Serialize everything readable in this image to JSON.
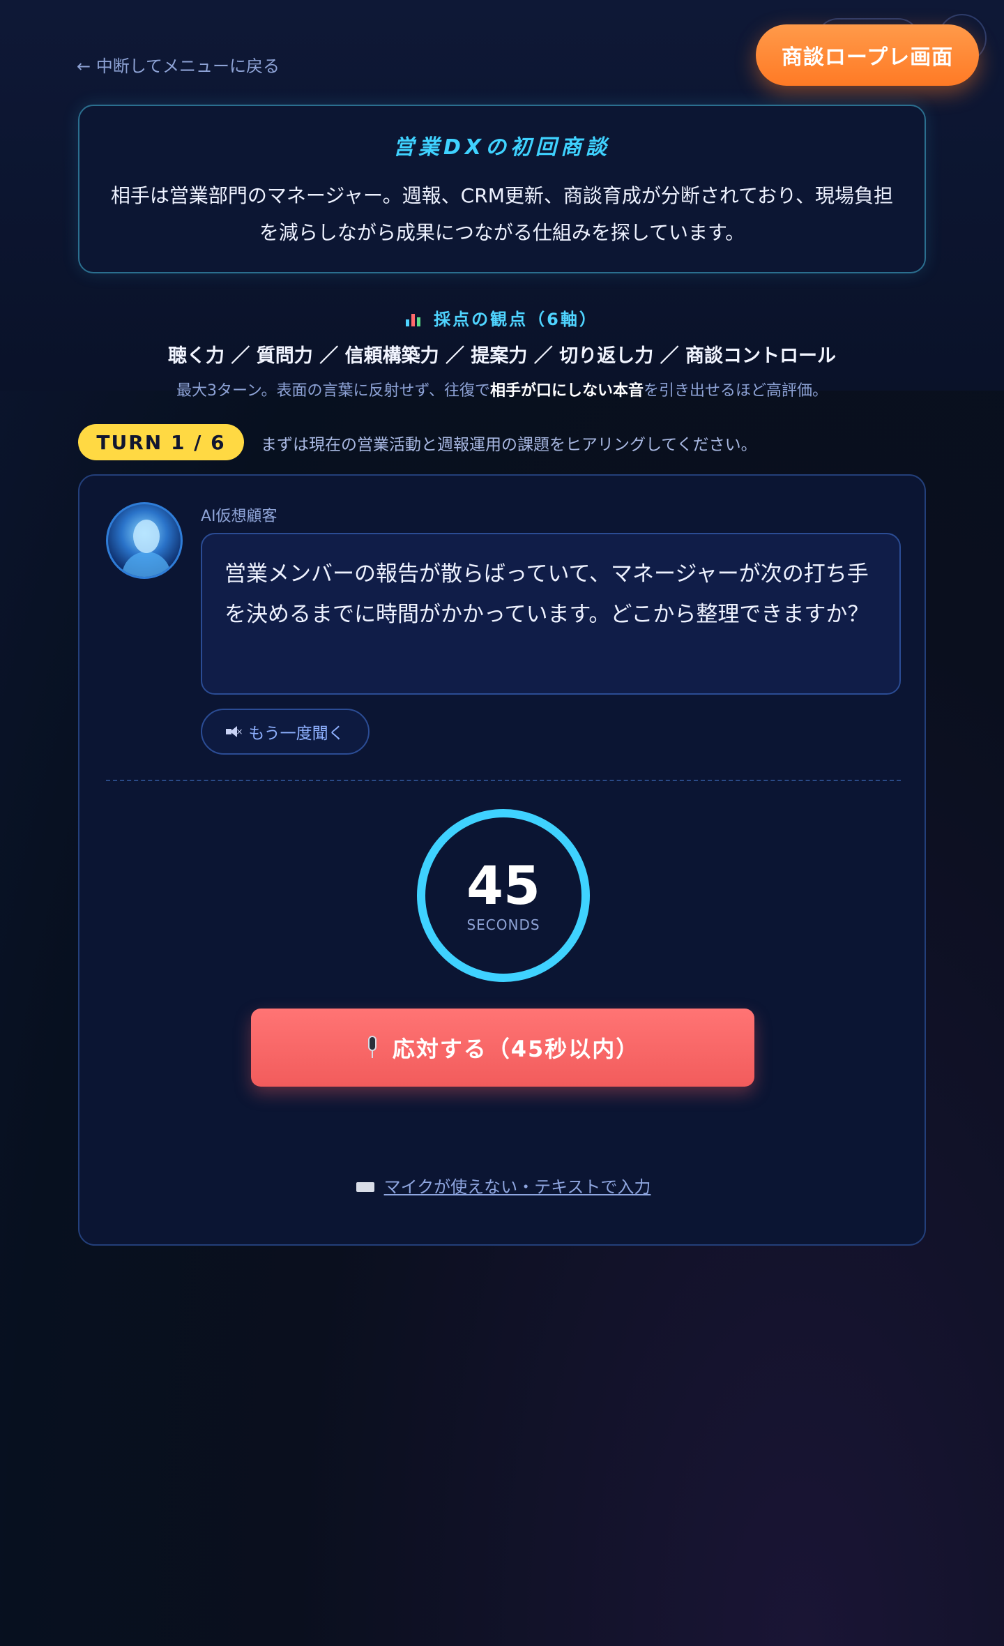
{
  "header": {
    "back_label": "← 中断してメニューに戻る",
    "screen_badge": "商談ロープレ画面"
  },
  "scenario": {
    "title": "営業DXの初回商談",
    "description": "相手は営業部門のマネージャー。週報、CRM更新、商談育成が分断されており、現場負担を減らしながら成果につながる仕組みを探しています。"
  },
  "criteria": {
    "title": "採点の観点（6軸）",
    "axes": "聴く力 ／ 質問力 ／ 信頼構築力 ／ 提案力 ／ 切り返し力 ／ 商談コントロール",
    "note_before": "最大3ターン。表面の言葉に反射せず、往復で",
    "note_bold": "相手が口にしない本音",
    "note_after": "を引き出せるほど高評価。"
  },
  "turn": {
    "label": "TURN 1 / 6",
    "hint": "まずは現在の営業活動と週報運用の課題をヒアリングしてください。"
  },
  "conversation": {
    "speaker": "AI仮想顧客",
    "message": "営業メンバーの報告が散らばっていて、マネージャーが次の打ち手を決めるまでに時間がかかっています。どこから整理できますか？",
    "replay_label": "もう一度聞く"
  },
  "timer": {
    "value": "45",
    "unit": "SECONDS"
  },
  "actions": {
    "respond_label": "応対する（45秒以内）",
    "text_input_label": "マイクが使えない・テキストで入力"
  },
  "colors": {
    "accent_cyan": "#3fd2ff",
    "badge_orange": "#ff8a33",
    "turn_yellow": "#ffd943",
    "respond_red": "#f96868"
  },
  "icons": {
    "back": "arrow-left-icon",
    "criteria": "bar-chart-icon",
    "replay": "speaker-icon",
    "respond": "microphone-icon",
    "text_input": "keyboard-icon"
  }
}
